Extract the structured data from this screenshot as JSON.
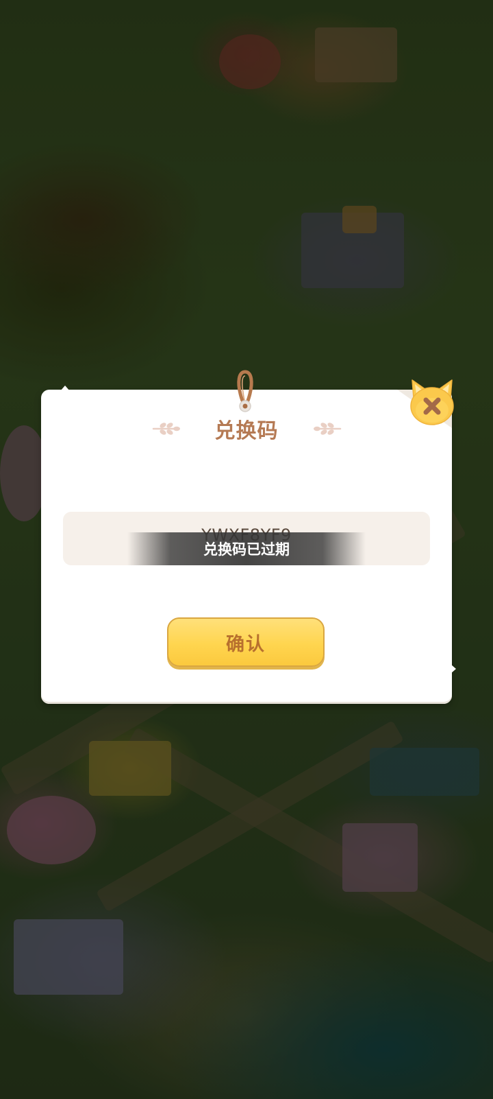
{
  "dialog": {
    "title": "兑换码",
    "code_value": "YWXF8YF9",
    "toast_message": "兑换码已过期",
    "confirm_label": "确认"
  },
  "icons": {
    "close": "cat-close-icon",
    "hanger": "rope-hanger-icon",
    "title_decor": "sprig-icon"
  },
  "colors": {
    "title": "#b57a54",
    "button_fill": "#ffd54f",
    "button_text": "#b8702e",
    "close_cat": "#fbc94c"
  }
}
